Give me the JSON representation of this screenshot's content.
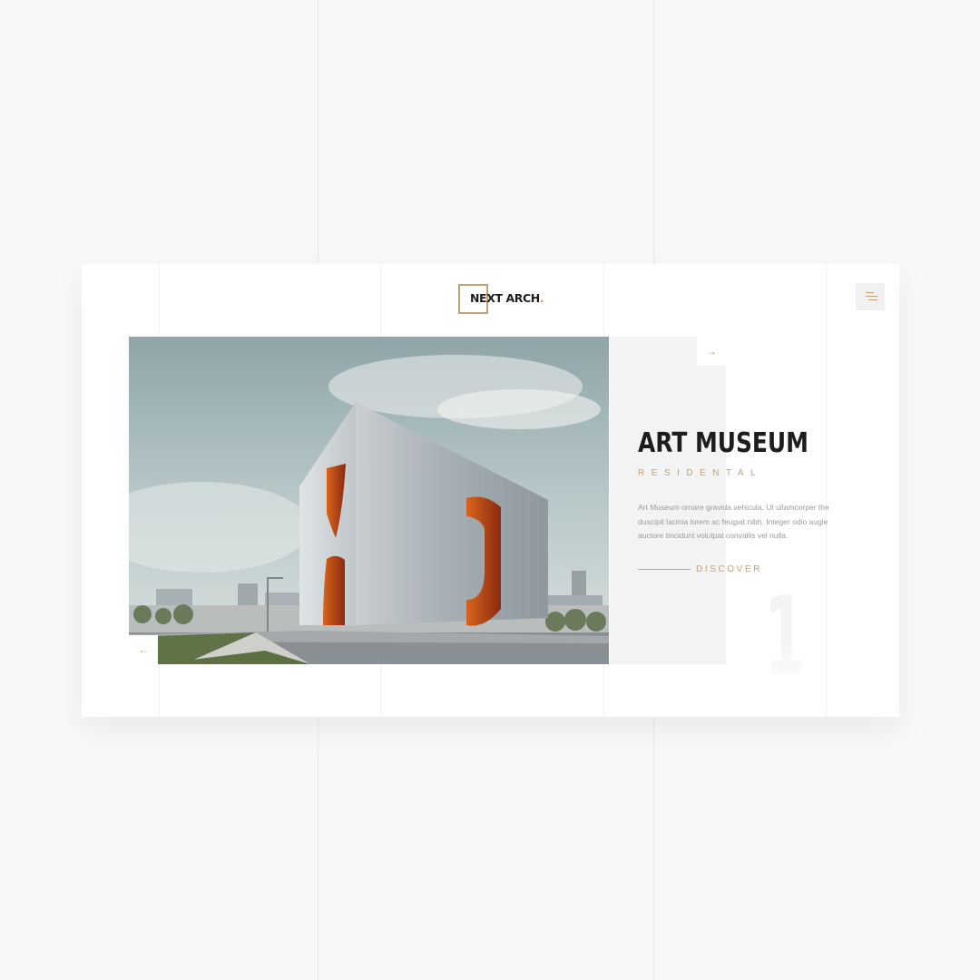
{
  "brand": {
    "logo_text": "NEXT ARCH",
    "logo_dot": ".",
    "accent_color": "#c4a173"
  },
  "header": {
    "menu_icon": "hamburger-menu-icon"
  },
  "slider": {
    "next_arrow": "→",
    "prev_arrow": "←",
    "current_slide": "1"
  },
  "project": {
    "title": "ART MUSEUM",
    "category": "RESIDENTAL",
    "description": "Art Museum ornare gravida vehicula. Ut ullamcorper the duscipit lacinia lorem ac feugiat nibh. Integer odio augle auctore tincidunt volutpat convallis vel nulla.",
    "cta_label": "DISCOVER"
  }
}
